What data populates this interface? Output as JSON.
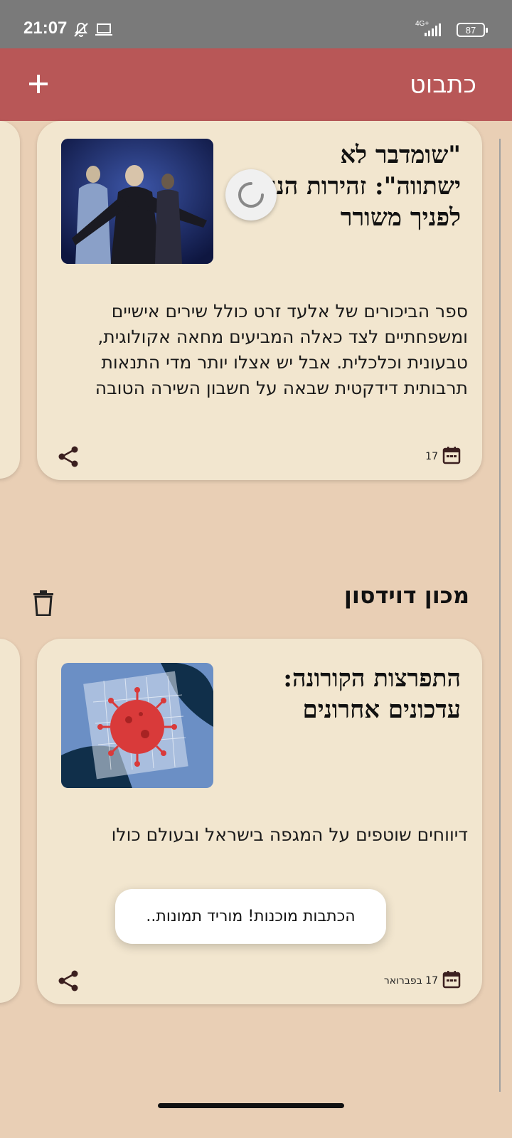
{
  "status_bar": {
    "time": "21:07",
    "network": "4G+",
    "battery": "87"
  },
  "app_bar": {
    "title": "כתבוט",
    "add_icon": "plus-icon"
  },
  "feeds": [
    {
      "source": "",
      "articles": [
        {
          "title": "\"שומדבר לא ישתווה\": זהירות הנה לפניך משורר",
          "summary": "ספר הביכורים של אלעד זרט כולל שירים אישיים ומשפחתיים לצד כאלה המביעים מחאה אקולוגית, טבעונית וכלכלית. אבל יש אצלו יותר מדי התנאות תרבותית דידקטית שבאה על חשבון השירה הטובה",
          "date": "17"
        }
      ]
    },
    {
      "source": "מכון דוידסון",
      "articles": [
        {
          "title": "התפרצות הקורונה: עדכונים אחרונים",
          "summary": "דיווחים שוטפים על המגפה בישראל ובעולם כולו",
          "date": "17 בפברואר"
        }
      ]
    }
  ],
  "toast": "הכתבות מוכנות! מוריד תמונות.."
}
